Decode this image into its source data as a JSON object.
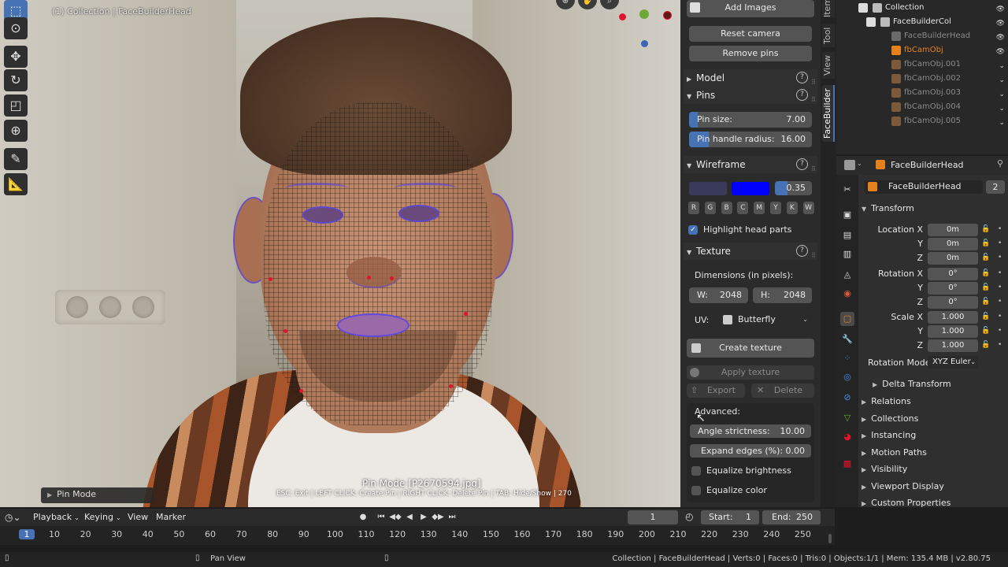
{
  "viewport": {
    "caption_top": "(1) Collection | FaceBuilderHead",
    "pin_mode_msg": "Pin Mode  [P2670594.jpg]",
    "help_msg": "ESC: Exit | LEFT CLICK: Create Pin | RIGHT CLICK: Delete Pin | TAB: Hide/Show | 270",
    "operator_panel": "Pin Mode",
    "gizmo_colors": {
      "x": "#e0142c",
      "y": "#6fa834",
      "z": "#3a66b4"
    }
  },
  "toolbar": {
    "tools": [
      "select-icon",
      "cursor-icon",
      "move-icon",
      "rotate-icon",
      "scale-icon",
      "transform-icon",
      "annotate-icon",
      "measure-icon"
    ]
  },
  "npanel": {
    "tabs": [
      "Item",
      "Tool",
      "View",
      "FaceBuilder"
    ],
    "add_images": "Add Images",
    "reset_camera": "Reset camera",
    "remove_pins": "Remove pins",
    "model": "Model",
    "pins": {
      "title": "Pins",
      "pin_size_label": "Pin size:",
      "pin_size_value": "7.00",
      "pin_size_fraction": 0.07,
      "handle_label": "Pin handle radius:",
      "handle_value": "16.00",
      "handle_fraction": 0.16
    },
    "wireframe": {
      "title": "Wireframe",
      "color1": "#3a3a5a",
      "color2": "#0000ff",
      "opacity_value": "0.35",
      "letters": [
        "R",
        "G",
        "B",
        "C",
        "M",
        "Y",
        "K",
        "W"
      ],
      "highlight_label": "Highlight head parts"
    },
    "texture": {
      "title": "Texture",
      "dims_label": "Dimensions (in pixels):",
      "w_label": "W:",
      "w_value": "2048",
      "h_label": "H:",
      "h_value": "2048",
      "uv_label": "UV:",
      "uv_value": "Butterfly",
      "create_texture": "Create texture",
      "apply_texture": "Apply texture",
      "export": "Export",
      "delete": "Delete",
      "advanced": "Advanced:",
      "angle_label": "Angle strictness:",
      "angle_value": "10.00",
      "expand_label": "Expand edges (%):",
      "expand_value": "0.00",
      "eq_brightness": "Equalize brightness",
      "eq_color": "Equalize color"
    }
  },
  "outliner": {
    "rows": [
      {
        "name": "Collection",
        "indent": 1,
        "color": "#e6e6e6"
      },
      {
        "name": "FaceBuilderCol",
        "indent": 2,
        "color": "#e6e6e6"
      },
      {
        "name": "FaceBuilderHead",
        "indent": 3,
        "color": "#8a8a8a"
      },
      {
        "name": "fbCamObj",
        "indent": 3,
        "color": "#e6821e"
      },
      {
        "name": "fbCamObj.001",
        "indent": 3,
        "color": "#8a8a8a"
      },
      {
        "name": "fbCamObj.002",
        "indent": 3,
        "color": "#8a8a8a"
      },
      {
        "name": "fbCamObj.003",
        "indent": 3,
        "color": "#8a8a8a"
      },
      {
        "name": "fbCamObj.004",
        "indent": 3,
        "color": "#8a8a8a"
      },
      {
        "name": "fbCamObj.005",
        "indent": 3,
        "color": "#8a8a8a"
      }
    ]
  },
  "properties": {
    "header_name": "FaceBuilderHead",
    "object_name": "FaceBuilderHead",
    "user_count": "2",
    "transform": "Transform",
    "location_label": "Location X",
    "rotation_label": "Rotation X",
    "scale_label": "Scale X",
    "y": "Y",
    "z": "Z",
    "loc": [
      "0m",
      "0m",
      "0m"
    ],
    "rot": [
      "0°",
      "0°",
      "0°"
    ],
    "scale": [
      "1.000",
      "1.000",
      "1.000"
    ],
    "rotation_mode_label": "Rotation Mode",
    "rotation_mode_value": "XYZ Euler",
    "delta": "Delta Transform",
    "sections": [
      "Relations",
      "Collections",
      "Instancing",
      "Motion Paths",
      "Visibility",
      "Viewport Display",
      "Custom Properties"
    ]
  },
  "timeline": {
    "menus": [
      "Playback",
      "Keying",
      "View",
      "Marker"
    ],
    "current_frame": "1",
    "start_label": "Start:",
    "start_value": "1",
    "end_label": "End:",
    "end_value": "250",
    "ticks": [
      "1",
      "10",
      "20",
      "30",
      "40",
      "50",
      "60",
      "70",
      "80",
      "90",
      "100",
      "110",
      "120",
      "130",
      "140",
      "150",
      "160",
      "170",
      "180",
      "190",
      "200",
      "210",
      "220",
      "230",
      "240",
      "250"
    ]
  },
  "statusbar": {
    "pan_view": "Pan View",
    "stats": "Collection | FaceBuilderHead | Verts:0 | Faces:0 | Tris:0 | Objects:1/1 | Mem: 135.4 MB | v2.80.75"
  }
}
